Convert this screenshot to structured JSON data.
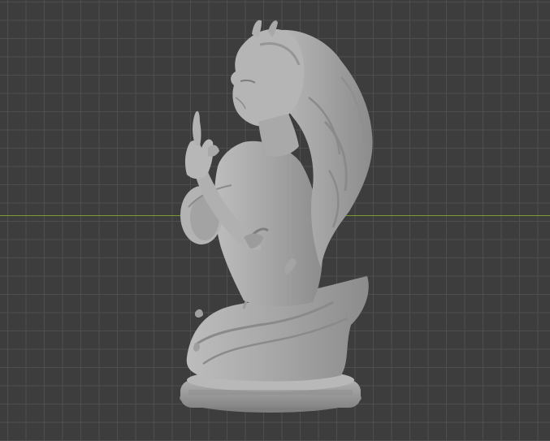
{
  "viewport": {
    "background_color": "#3d3d3d",
    "grid_color": "#505050",
    "x_axis_color": "#7a9c34"
  },
  "model": {
    "icon": "sculpted-bust-mesh",
    "mesh_color": "#a9a9a9",
    "shadow_color": "#7d7d7d",
    "highlight_color": "#c8c8c8"
  }
}
